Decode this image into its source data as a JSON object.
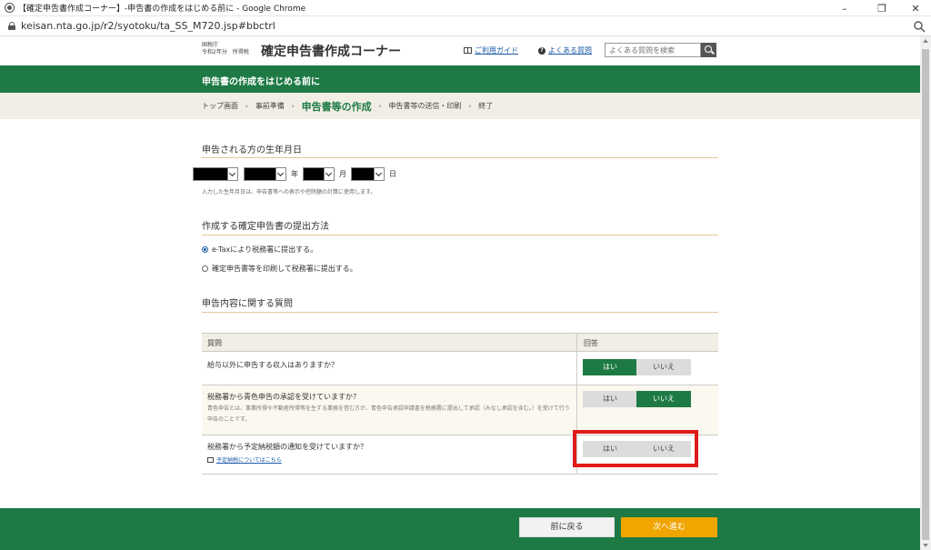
{
  "browser": {
    "window_title": "【確定申告書作成コーナー】-申告書の作成をはじめる前に - Google Chrome",
    "url": "keisan.nta.go.jp/r2/syotoku/ta_SS_M720.jsp#bbctrl",
    "minimize": "–",
    "restore": "❐",
    "close": "✕"
  },
  "header": {
    "agency_line1": "国税庁",
    "agency_line2": "令和2年分　所得税",
    "title": "確定申告書作成コーナー",
    "guide_link": "ご利用ガイド",
    "faq_link": "よくある質問",
    "search_placeholder": "よくある質問を検索"
  },
  "page_heading": "申告書の作成をはじめる前に",
  "breadcrumb": {
    "items": [
      "トップ画面",
      "事前準備",
      "申告書等の作成",
      "申告書等の送信・印刷",
      "終了"
    ],
    "separator": "›",
    "current_index": 2
  },
  "birthdate": {
    "title": "申告される方の生年月日",
    "year_unit": "年",
    "month_unit": "月",
    "day_unit": "日",
    "note": "入力した生年月日は、申告書等への表示や控除額の計算に使用します。"
  },
  "submission": {
    "title": "作成する確定申告書の提出方法",
    "options": [
      {
        "label": "e-Taxにより税務署に提出する。",
        "selected": true
      },
      {
        "label": "確定申告書等を印刷して税務署に提出する。",
        "selected": false
      }
    ]
  },
  "questions": {
    "title": "申告内容に関する質問",
    "col_question": "質問",
    "col_answer": "回答",
    "yes_label": "はい",
    "no_label": "いいえ",
    "rows": [
      {
        "text": "給与以外に申告する収入はありますか？",
        "answer": "yes"
      },
      {
        "text": "税務署から青色申告の承認を受けていますか？",
        "desc": "青色申告とは、事業所得や不動産所得等を生ずる業務を営む方が、青色申告承認申請書を税務署に提出して承認（みなし承認を含む。）を受けて行う申告のことです。",
        "answer": "no"
      },
      {
        "text": "税務署から予定納税額の通知を受けていますか？",
        "link": "予定納税についてはこちら",
        "answer": "none"
      }
    ]
  },
  "footer": {
    "back_label": "前に戻る",
    "next_label": "次へ進む"
  },
  "colors": {
    "brand_green": "#1e7a45",
    "next_orange": "#f0a500",
    "highlight_red": "#e01a1a"
  }
}
